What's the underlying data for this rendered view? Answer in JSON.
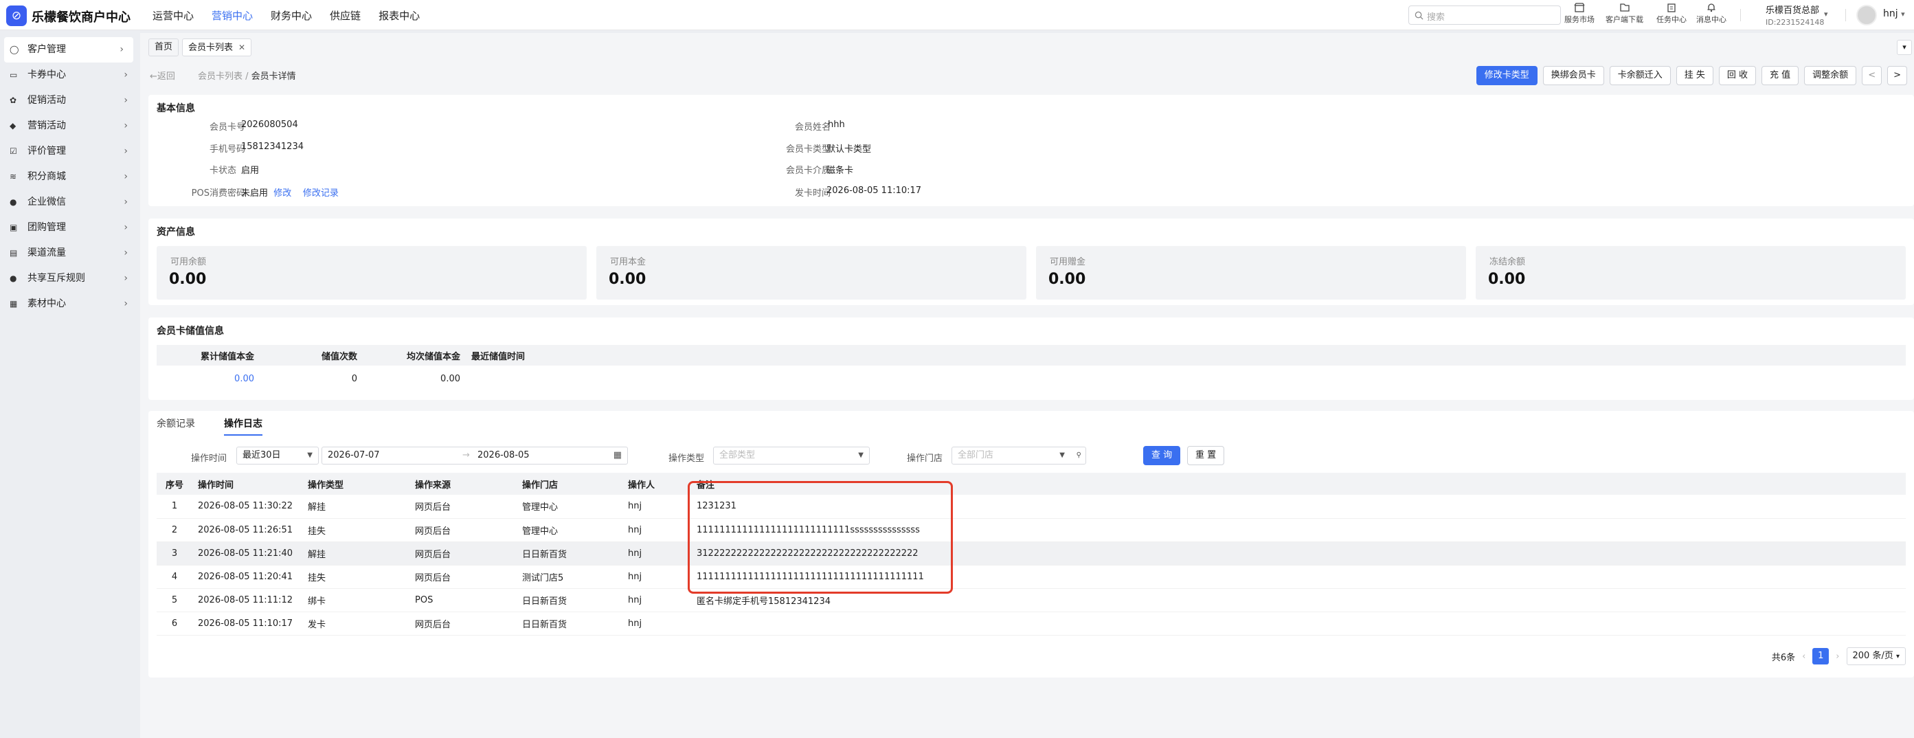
{
  "app": {
    "title": "乐檬餐饮商户中心",
    "logo_glyph": "⊘"
  },
  "topnav": [
    "运营中心",
    "营销中心",
    "财务中心",
    "供应链",
    "报表中心"
  ],
  "topnav_active": 1,
  "search": {
    "placeholder": "搜索"
  },
  "tools": [
    {
      "label": "服务市场",
      "icon": "store-icon"
    },
    {
      "label": "客户端下载",
      "icon": "download-icon"
    },
    {
      "label": "任务中心",
      "icon": "task-icon"
    },
    {
      "label": "消息中心",
      "icon": "bell-icon"
    }
  ],
  "org": {
    "name": "乐檬百货总部",
    "id": "ID:2231524148"
  },
  "user": {
    "name": "hnj"
  },
  "sidebar": [
    {
      "label": "客户管理",
      "icon": "user-icon"
    },
    {
      "label": "卡券中心",
      "icon": "card-icon"
    },
    {
      "label": "促销活动",
      "icon": "promo-icon"
    },
    {
      "label": "营销活动",
      "icon": "tag-icon"
    },
    {
      "label": "评价管理",
      "icon": "review-icon"
    },
    {
      "label": "积分商城",
      "icon": "points-icon"
    },
    {
      "label": "企业微信",
      "icon": "wechat-icon"
    },
    {
      "label": "团购管理",
      "icon": "group-buy-icon"
    },
    {
      "label": "渠道流量",
      "icon": "channel-icon"
    },
    {
      "label": "共享互斥规则",
      "icon": "info-icon"
    },
    {
      "label": "素材中心",
      "icon": "material-icon"
    }
  ],
  "tabs": {
    "home": "首页",
    "current": "会员卡列表"
  },
  "breadcrumb": {
    "back": "返回",
    "parent": "会员卡列表",
    "sep": "/",
    "current": "会员卡详情"
  },
  "actions": [
    "修改卡类型",
    "换绑会员卡",
    "卡余额迁入",
    "挂 失",
    "回 收",
    "充 值",
    "调整余额"
  ],
  "basic": {
    "title": "基本信息",
    "card_no_label": "会员卡号",
    "card_no": "2026080504",
    "phone_label": "手机号码",
    "phone": "15812341234",
    "status_label": "卡状态",
    "status": "启用",
    "pos_label": "POS消费密码",
    "pos": "未启用",
    "pos_edit": "修改",
    "pos_log": "修改记录",
    "name_label": "会员姓名",
    "name": "hhh",
    "type_label": "会员卡类型",
    "type": "默认卡类型",
    "medium_label": "会员卡介质",
    "medium": "磁条卡",
    "issue_label": "发卡时间",
    "issue": "2026-08-05 11:10:17"
  },
  "assets": {
    "title": "资产信息",
    "items": [
      {
        "label": "可用余额",
        "value": "0.00"
      },
      {
        "label": "可用本金",
        "value": "0.00"
      },
      {
        "label": "可用赠金",
        "value": "0.00"
      },
      {
        "label": "冻结余额",
        "value": "0.00"
      }
    ]
  },
  "stored": {
    "title": "会员卡储值信息",
    "headers": [
      "累计储值本金",
      "储值次数",
      "均次储值本金",
      "最近储值时间"
    ],
    "row": [
      "0.00",
      "0",
      "0.00",
      ""
    ]
  },
  "log": {
    "subtabs": [
      "余额记录",
      "操作日志"
    ],
    "active_subtab": 1,
    "filters": {
      "time_label": "操作时间",
      "range": "最近30日",
      "start": "2026-07-07",
      "arrow": "→",
      "end": "2026-08-05",
      "type_label": "操作类型",
      "type_ph": "全部类型",
      "store_label": "操作门店",
      "store_ph": "全部门店",
      "query": "查 询",
      "reset": "重 置"
    },
    "headers": [
      "序号",
      "操作时间",
      "操作类型",
      "操作来源",
      "操作门店",
      "操作人",
      "备注"
    ],
    "rows": [
      [
        "1",
        "2026-08-05 11:30:22",
        "解挂",
        "网页后台",
        "管理中心",
        "hnj",
        "1231231"
      ],
      [
        "2",
        "2026-08-05 11:26:51",
        "挂失",
        "网页后台",
        "管理中心",
        "hnj",
        "111111111111111111111111111sssssssssssssss"
      ],
      [
        "3",
        "2026-08-05 11:21:40",
        "解挂",
        "网页后台",
        "日日新百货",
        "hnj",
        "312222222222222222222222222222222222222"
      ],
      [
        "4",
        "2026-08-05 11:20:41",
        "挂失",
        "网页后台",
        "测试门店5",
        "hnj",
        "1111111111111111111111111111111111111111"
      ],
      [
        "5",
        "2026-08-05 11:11:12",
        "绑卡",
        "POS",
        "日日新百货",
        "hnj",
        "匿名卡绑定手机号15812341234"
      ],
      [
        "6",
        "2026-08-05 11:10:17",
        "发卡",
        "网页后台",
        "日日新百货",
        "hnj",
        ""
      ]
    ],
    "highlight_row": 2,
    "pager": {
      "total": "共6条",
      "page": "1",
      "size": "200 条/页"
    }
  },
  "colors": {
    "accent": "#3a6ff0",
    "highlight_border": "#e33c2a"
  }
}
